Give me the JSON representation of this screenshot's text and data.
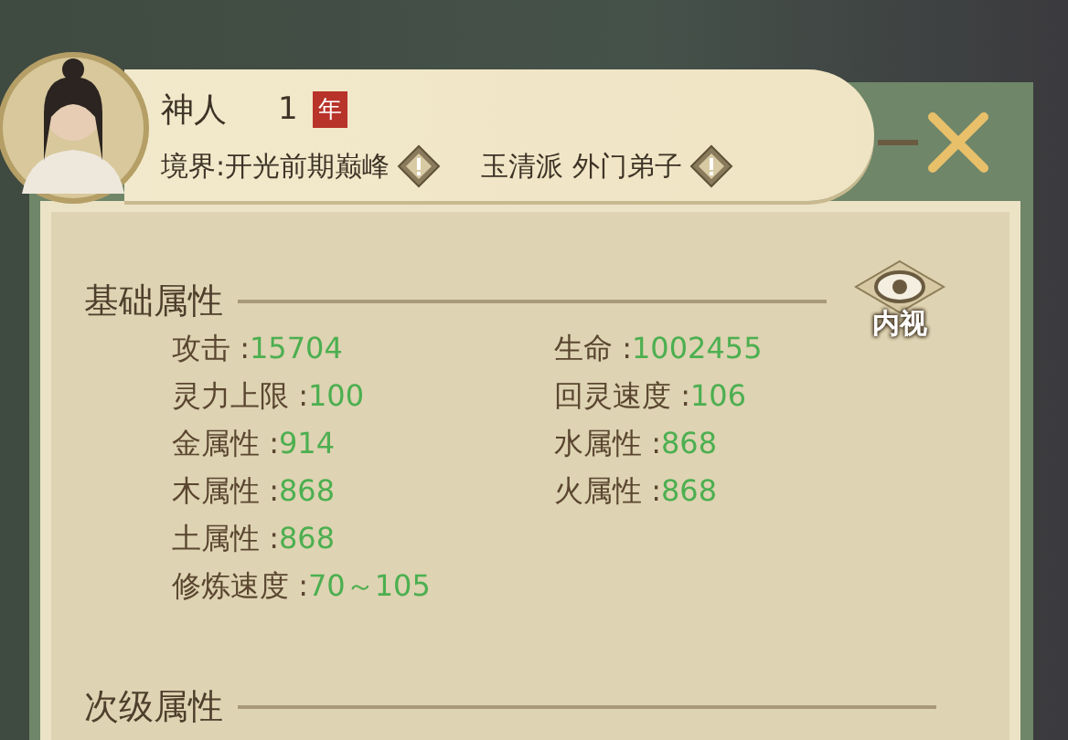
{
  "character": {
    "name": "神人",
    "level": "1",
    "level_badge": "年",
    "realm": "境界:开光前期巅峰",
    "sect": "玉清派 外门弟子"
  },
  "inner_view_button": "内视",
  "basic": {
    "title": "基础属性",
    "left": [
      {
        "label": "攻击 :",
        "value": "15704"
      },
      {
        "label": "灵力上限 :",
        "value": "100"
      },
      {
        "label": "金属性 :",
        "value": "914"
      },
      {
        "label": "木属性 :",
        "value": "868"
      },
      {
        "label": "土属性 :",
        "value": "868"
      },
      {
        "label": "修炼速度 :",
        "value": "70～105"
      }
    ],
    "right": [
      {
        "label": "生命 :",
        "value": "1002455"
      },
      {
        "label": "回灵速度 :",
        "value": "106"
      },
      {
        "label": "水属性 :",
        "value": "868"
      },
      {
        "label": "火属性 :",
        "value": "868"
      }
    ]
  },
  "secondary": {
    "title": "次级属性"
  }
}
